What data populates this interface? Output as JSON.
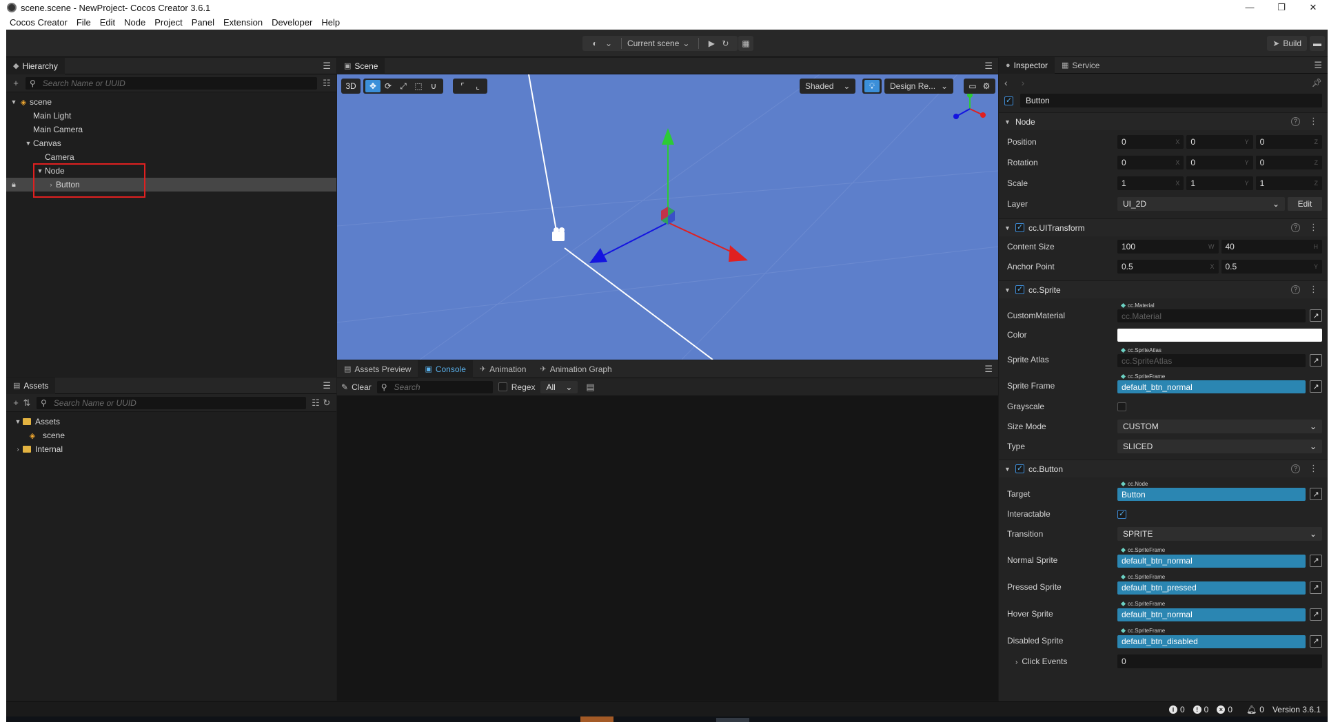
{
  "window": {
    "title": "scene.scene - NewProject- Cocos Creator 3.6.1",
    "controls": [
      "—",
      "❐",
      "✕"
    ]
  },
  "menu": [
    "Cocos Creator",
    "File",
    "Edit",
    "Node",
    "Project",
    "Panel",
    "Extension",
    "Developer",
    "Help"
  ],
  "toolbar": {
    "scene_label": "Current scene",
    "build_label": "Build"
  },
  "hierarchy": {
    "tab": "Hierarchy",
    "search_placeholder": "Search Name or UUID",
    "nodes": {
      "scene": "scene",
      "main_light": "Main Light",
      "main_camera": "Main Camera",
      "canvas": "Canvas",
      "camera": "Camera",
      "node": "Node",
      "button": "Button"
    }
  },
  "assets": {
    "tab": "Assets",
    "search_placeholder": "Search Name or UUID",
    "items": {
      "assets": "Assets",
      "scene": "scene",
      "internal": "Internal"
    }
  },
  "scene": {
    "tab": "Scene",
    "mode_3d": "3D",
    "shading": "Shaded",
    "design_resolution": "Design Re..."
  },
  "console": {
    "tabs": [
      "Assets Preview",
      "Console",
      "Animation",
      "Animation Graph"
    ],
    "clear": "Clear",
    "search_placeholder": "Search",
    "regex": "Regex",
    "filter": "All"
  },
  "inspector": {
    "tabs": [
      "Inspector",
      "Service"
    ],
    "node_name": "Button",
    "node_section": "Node",
    "position": [
      "0",
      "0",
      "0"
    ],
    "rotation": [
      "0",
      "0",
      "0"
    ],
    "scale": [
      "1",
      "1",
      "1"
    ],
    "axes": [
      "X",
      "Y",
      "Z"
    ],
    "layer": "UI_2D",
    "edit": "Edit",
    "labels": {
      "position": "Position",
      "rotation": "Rotation",
      "scale": "Scale",
      "layer": "Layer",
      "content_size": "Content Size",
      "anchor_point": "Anchor Point",
      "custom_material": "CustomMaterial",
      "color": "Color",
      "sprite_atlas": "Sprite Atlas",
      "sprite_frame": "Sprite Frame",
      "grayscale": "Grayscale",
      "size_mode": "Size Mode",
      "type": "Type",
      "target": "Target",
      "interactable": "Interactable",
      "transition": "Transition",
      "normal_sprite": "Normal Sprite",
      "pressed_sprite": "Pressed Sprite",
      "hover_sprite": "Hover Sprite",
      "disabled_sprite": "Disabled Sprite",
      "click_events": "Click Events"
    },
    "ui_transform": {
      "title": "cc.UITransform",
      "content_size": [
        "100",
        "40"
      ],
      "size_axes": [
        "W",
        "H"
      ],
      "anchor": [
        "0.5",
        "0.5"
      ],
      "anchor_axes": [
        "X",
        "Y"
      ]
    },
    "sprite": {
      "title": "cc.Sprite",
      "material_type": "cc.Material",
      "material_placeholder": "cc.Material",
      "atlas_type": "cc.SpriteAtlas",
      "atlas_placeholder": "cc.SpriteAtlas",
      "frame_type": "cc.SpriteFrame",
      "frame": "default_btn_normal",
      "color": "#ffffff",
      "size_mode": "CUSTOM",
      "type": "SLICED"
    },
    "button": {
      "title": "cc.Button",
      "target_type": "cc.Node",
      "target": "Button",
      "transition": "SPRITE",
      "sprite_type": "cc.SpriteFrame",
      "normal": "default_btn_normal",
      "pressed": "default_btn_pressed",
      "hover": "default_btn_normal",
      "disabled": "default_btn_disabled",
      "click_events": "0"
    }
  },
  "status": {
    "info_count": "0",
    "warn_count": "0",
    "error_count": "0",
    "notice_count": "0",
    "version": "Version 3.6.1"
  },
  "colors": {
    "accent": "#3b8fd9",
    "asset_filled": "#2b86b2",
    "scene_bg": "#5d7fcb",
    "highlight": "#e02020"
  }
}
